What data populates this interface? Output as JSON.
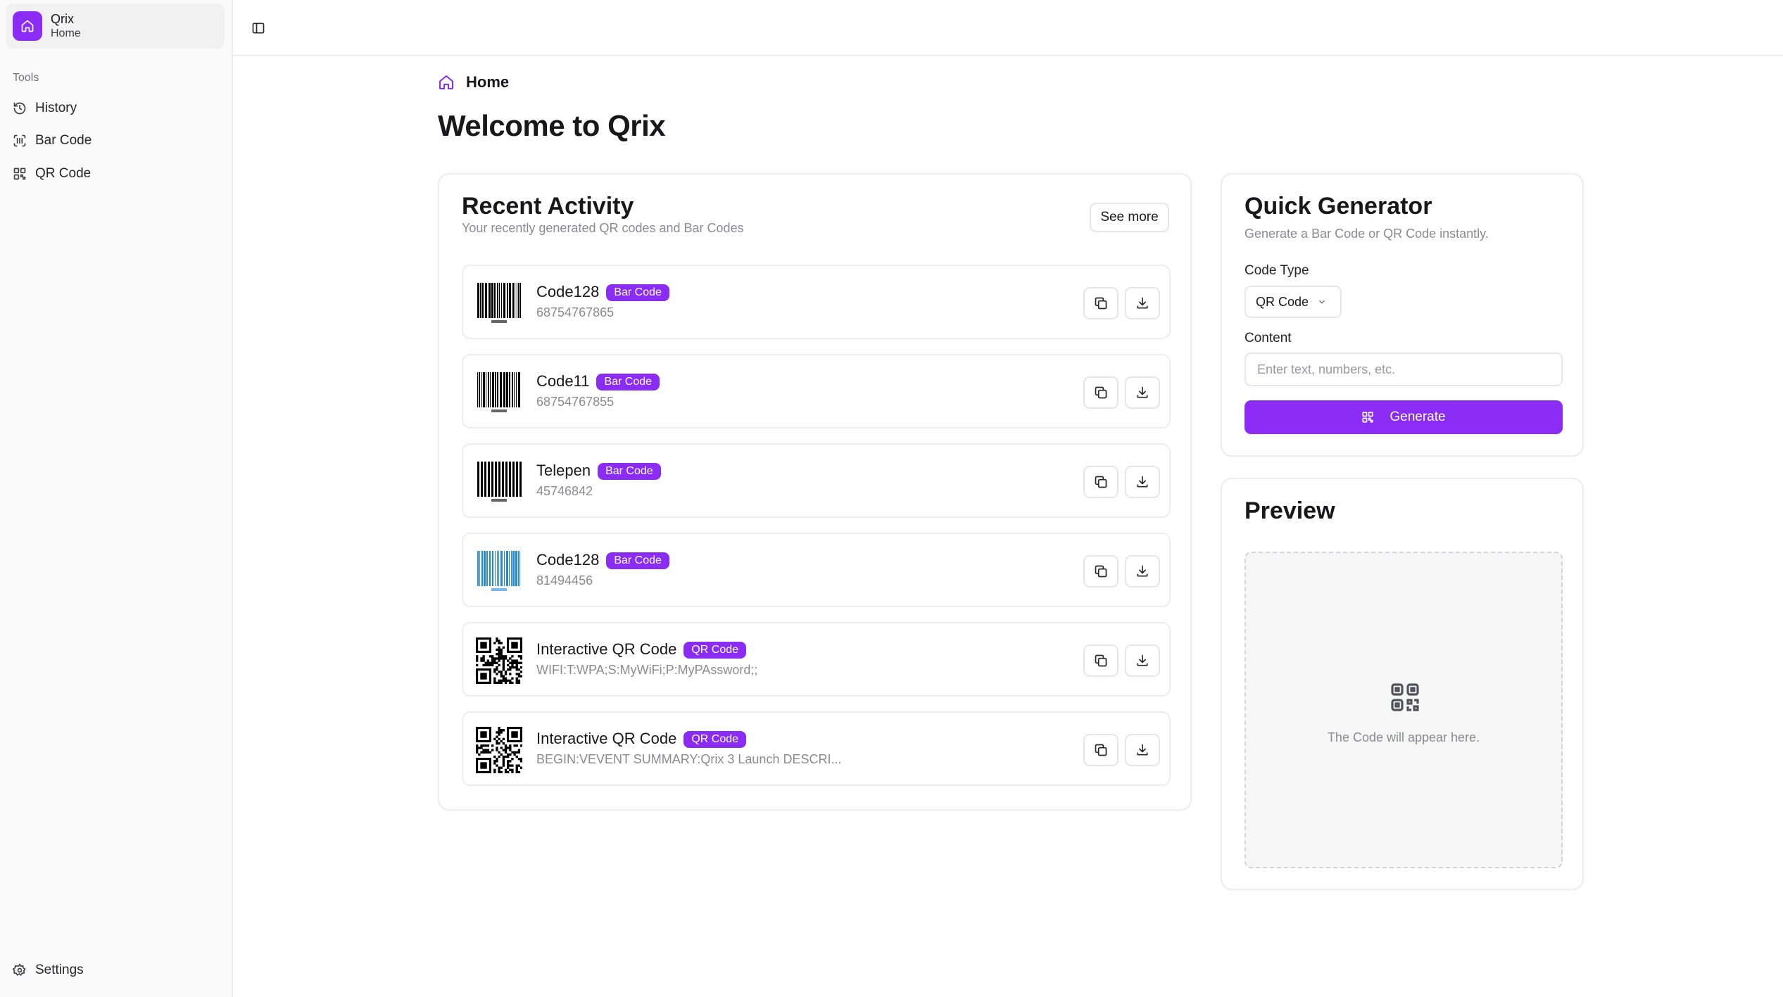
{
  "app": {
    "name": "Qrix",
    "subtitle": "Home"
  },
  "sidebar": {
    "group_label": "Tools",
    "items": [
      {
        "label": "History",
        "icon": "history-icon"
      },
      {
        "label": "Bar Code",
        "icon": "barcode-icon"
      },
      {
        "label": "QR Code",
        "icon": "qr-code-icon"
      }
    ],
    "settings_label": "Settings"
  },
  "breadcrumb": {
    "label": "Home"
  },
  "page_title": "Welcome to Qrix",
  "recent_activity": {
    "title": "Recent Activity",
    "subtitle": "Your recently generated QR codes and Bar Codes",
    "see_more_label": "See more",
    "items": [
      {
        "title": "Code128",
        "badge": "Bar Code",
        "value": "68754767865",
        "thumb": "barcode",
        "color": "#000000"
      },
      {
        "title": "Code11",
        "badge": "Bar Code",
        "value": "68754767855",
        "thumb": "barcode",
        "color": "#000000"
      },
      {
        "title": "Telepen",
        "badge": "Bar Code",
        "value": "45746842",
        "thumb": "barcode",
        "color": "#000000"
      },
      {
        "title": "Code128",
        "badge": "Bar Code",
        "value": "81494456",
        "thumb": "barcode",
        "color": "#1e88e5"
      },
      {
        "title": "Interactive QR Code",
        "badge": "QR Code",
        "value": "WIFI:T:WPA;S:MyWiFi;P:MyPAssword;;",
        "thumb": "qr",
        "color": "#000000"
      },
      {
        "title": "Interactive QR Code",
        "badge": "QR Code",
        "value": "BEGIN:VEVENT SUMMARY:Qrix 3 Launch DESCRI...",
        "thumb": "qr",
        "color": "#000000"
      }
    ]
  },
  "quick_generator": {
    "title": "Quick Generator",
    "subtitle": "Generate a Bar Code or QR Code instantly.",
    "code_type_label": "Code Type",
    "code_type_value": "QR Code",
    "content_label": "Content",
    "content_placeholder": "Enter text, numbers, etc.",
    "generate_label": "Generate"
  },
  "preview": {
    "title": "Preview",
    "empty_text": "The Code will appear here."
  },
  "colors": {
    "accent": "#8b2cf5"
  }
}
